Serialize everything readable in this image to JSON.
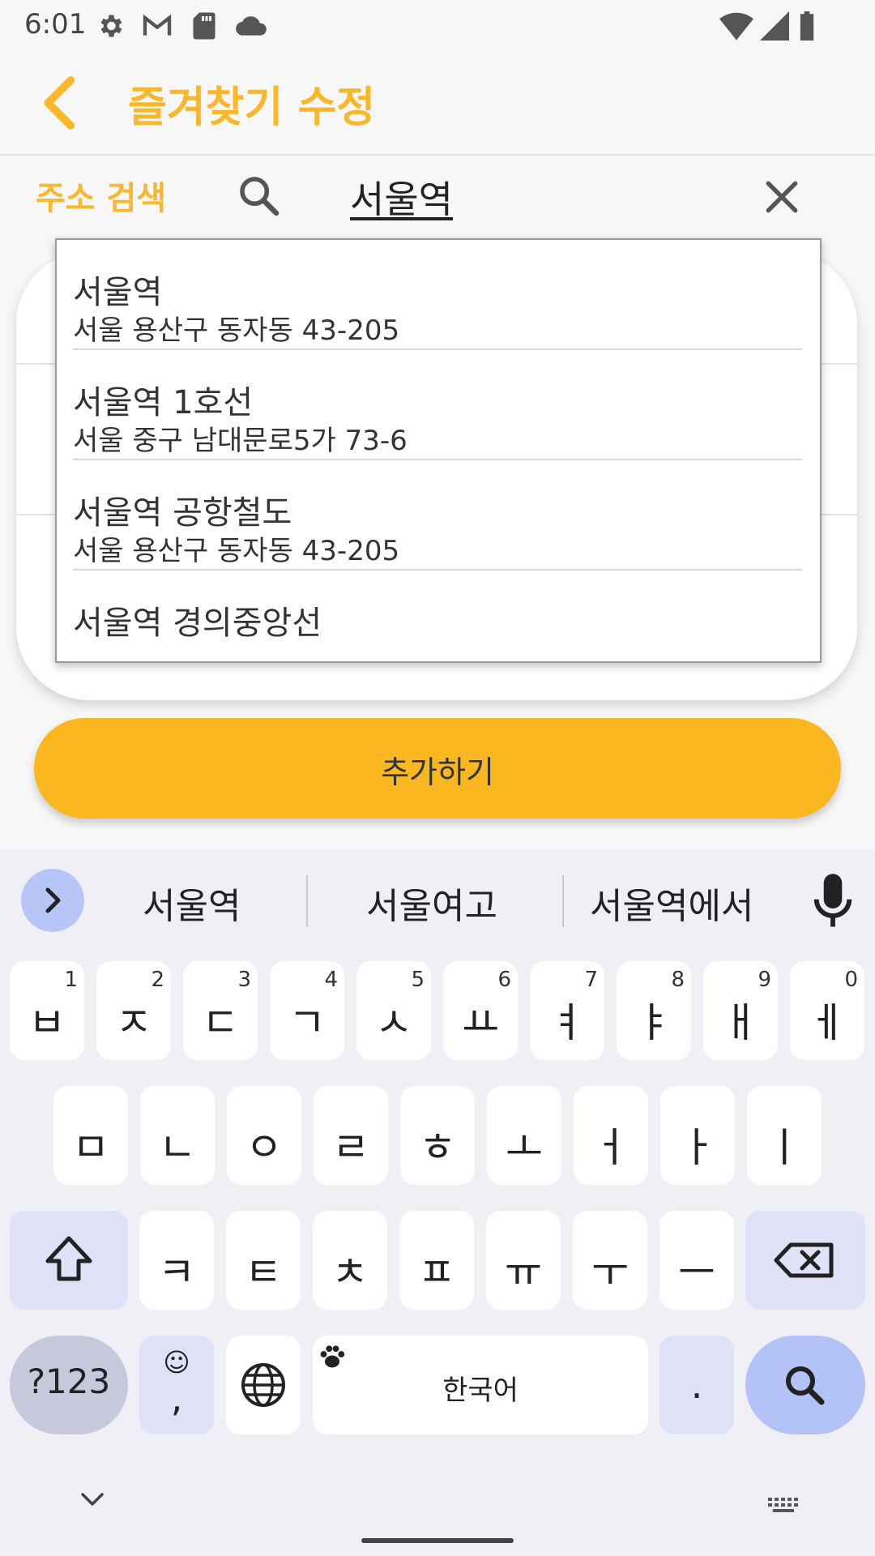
{
  "status_bar": {
    "time": "6:01",
    "icons": [
      "settings-icon",
      "gmail-icon",
      "sd-card-icon",
      "cloud-icon",
      "wifi-icon",
      "signal-icon",
      "battery-icon"
    ]
  },
  "app_bar": {
    "title": "즐겨찾기 수정",
    "accent_color": "#fbb72a"
  },
  "search": {
    "label": "주소 검색",
    "value": "서울역"
  },
  "suggestions_dropdown": {
    "items": [
      {
        "name": "서울역",
        "address": "서울 용산구 동자동 43-205"
      },
      {
        "name": "서울역 1호선",
        "address": "서울 중구 남대문로5가 73-6"
      },
      {
        "name": "서울역 공항철도",
        "address": "서울 용산구 동자동 43-205"
      },
      {
        "name": "서울역 경의중앙선",
        "address": ""
      }
    ]
  },
  "add_button": {
    "label": "추가하기",
    "color": "#fbb720"
  },
  "keyboard": {
    "suggestions": [
      "서울역",
      "서울여고",
      "서울역에서"
    ],
    "row1": [
      {
        "k": "ㅂ",
        "h": "1"
      },
      {
        "k": "ㅈ",
        "h": "2"
      },
      {
        "k": "ㄷ",
        "h": "3"
      },
      {
        "k": "ㄱ",
        "h": "4"
      },
      {
        "k": "ㅅ",
        "h": "5"
      },
      {
        "k": "ㅛ",
        "h": "6"
      },
      {
        "k": "ㅕ",
        "h": "7"
      },
      {
        "k": "ㅑ",
        "h": "8"
      },
      {
        "k": "ㅐ",
        "h": "9"
      },
      {
        "k": "ㅔ",
        "h": "0"
      }
    ],
    "row2": [
      "ㅁ",
      "ㄴ",
      "ㅇ",
      "ㄹ",
      "ㅎ",
      "ㅗ",
      "ㅓ",
      "ㅏ",
      "ㅣ"
    ],
    "row3": [
      "ㅋ",
      "ㅌ",
      "ㅊ",
      "ㅍ",
      "ㅠ",
      "ㅜ",
      "ㅡ"
    ],
    "symbols_key": "?123",
    "emoji_key": "☺",
    "comma_key": ",",
    "space_label": "한국어",
    "period_key": "."
  }
}
